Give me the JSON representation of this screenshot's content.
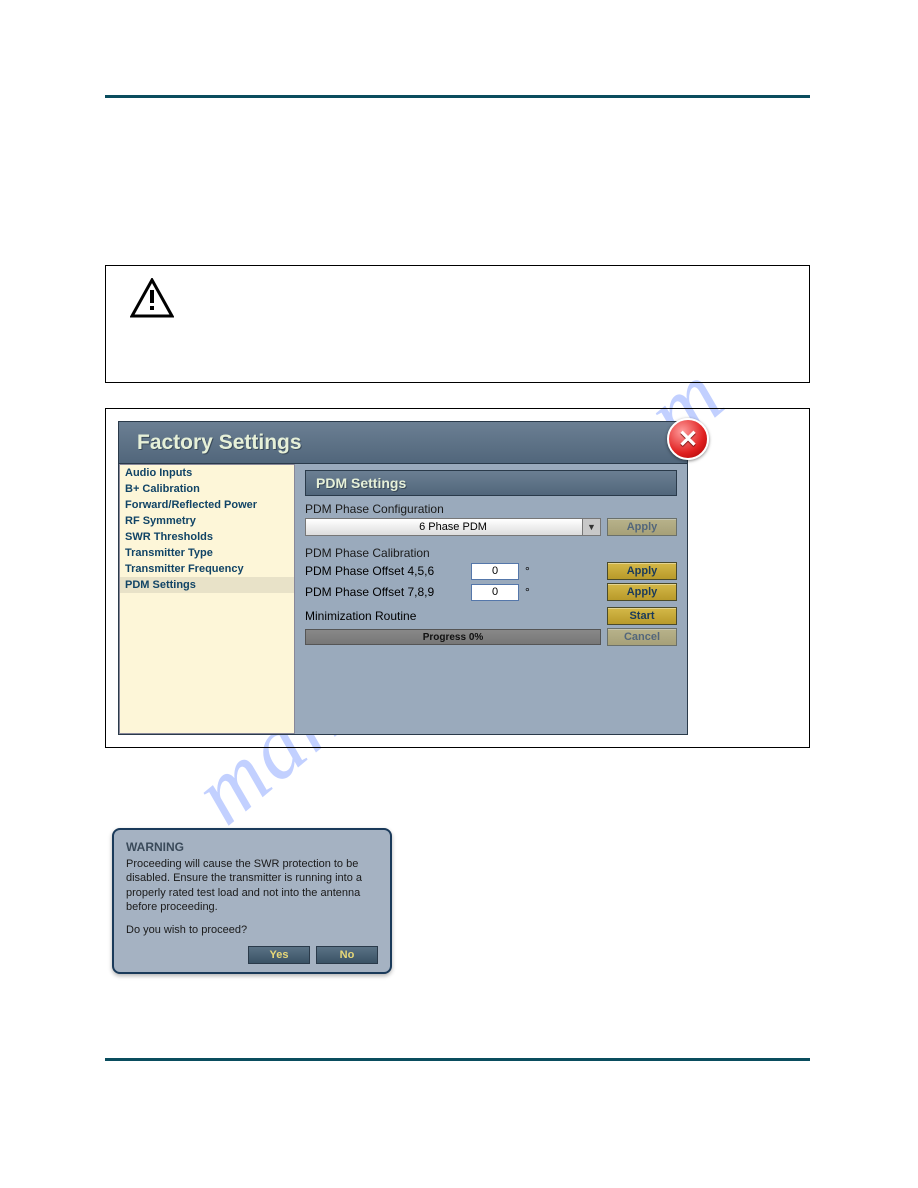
{
  "watermark": "manualshive.com",
  "factory": {
    "title": "Factory Settings",
    "sidebar": {
      "items": [
        {
          "label": "Audio Inputs"
        },
        {
          "label": "B+ Calibration"
        },
        {
          "label": "Forward/Reflected Power"
        },
        {
          "label": "RF Symmetry"
        },
        {
          "label": "SWR Thresholds"
        },
        {
          "label": "Transmitter Type"
        },
        {
          "label": "Transmitter Frequency"
        },
        {
          "label": "PDM Settings"
        }
      ],
      "selected_index": 7
    },
    "section_title": "PDM Settings",
    "phase_config": {
      "label": "PDM Phase Configuration",
      "selected": "6 Phase PDM",
      "apply": "Apply"
    },
    "phase_calib": {
      "label": "PDM Phase Calibration",
      "offset1_label": "PDM Phase Offset 4,5,6",
      "offset1_value": "0",
      "offset2_label": "PDM Phase Offset 7,8,9",
      "offset2_value": "0",
      "unit": "°",
      "apply": "Apply"
    },
    "minimization": {
      "label": "Minimization Routine",
      "progress": "Progress 0%",
      "start": "Start",
      "cancel": "Cancel"
    }
  },
  "warning_dialog": {
    "title": "WARNING",
    "body": "Proceeding will cause the SWR protection to be disabled. Ensure the transmitter is running into a properly rated test load and not into the antenna before proceeding.",
    "prompt": "Do you wish to proceed?",
    "yes": "Yes",
    "no": "No"
  }
}
